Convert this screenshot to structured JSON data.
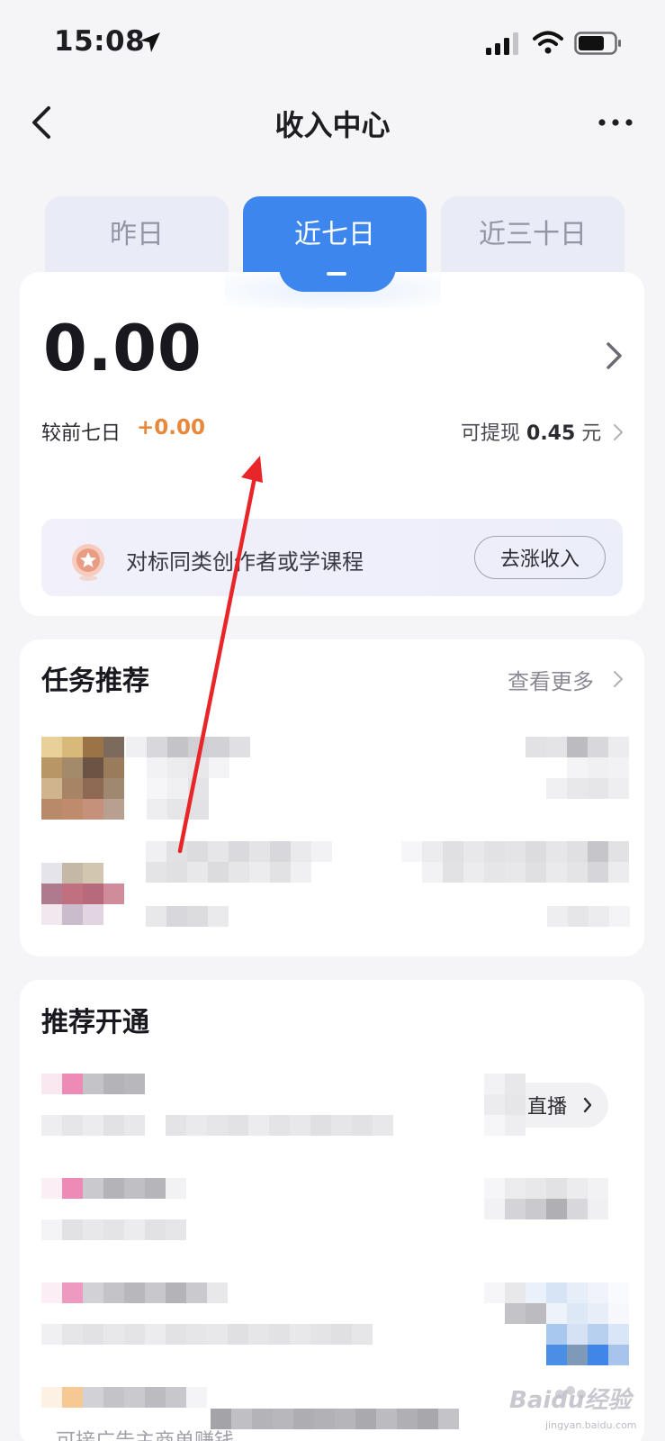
{
  "status_bar": {
    "time": "15:08"
  },
  "nav": {
    "title": "收入中心"
  },
  "tabs": [
    {
      "label": "昨日",
      "active": false
    },
    {
      "label": "近七日",
      "active": true
    },
    {
      "label": "近三十日",
      "active": false
    }
  ],
  "income": {
    "amount": "0.00",
    "compare_label": "较前七日",
    "compare_value": "+0.00",
    "withdraw_label": "可提现",
    "withdraw_value": "0.45",
    "withdraw_unit": "元"
  },
  "promo": {
    "text": "对标同类创作者或学课程",
    "button_label": "去涨收入"
  },
  "tasks": {
    "title": "任务推荐",
    "see_more": "查看更多"
  },
  "recommend": {
    "title": "推荐开通",
    "live_label": "直播",
    "bottom_text": "可接广告主商单赚钱"
  },
  "watermark": {
    "text": "Baidu经验",
    "sub": "jingyan.baidu.com"
  },
  "colors": {
    "accent_blue": "#3d86ee",
    "orange_value": "#e8883a",
    "annotation_red": "#e8262a"
  }
}
